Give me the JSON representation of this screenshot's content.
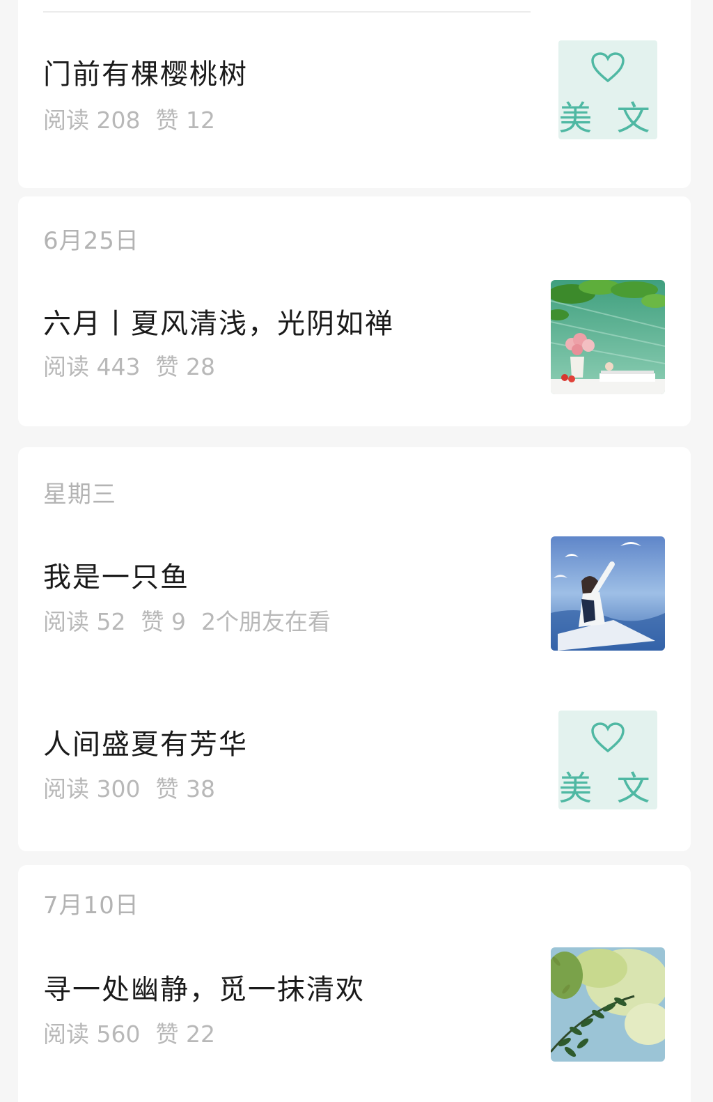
{
  "articles": [
    {
      "title": "门前有棵樱桃树",
      "reads": "阅读 208",
      "likes": "赞 12",
      "thumb_type": "meiwen",
      "thumb_text": "美 文"
    },
    {
      "date": "6月25日",
      "title": "六月丨夏风清浅，光阴如禅",
      "reads": "阅读 443",
      "likes": "赞 28",
      "thumb_type": "photo-lake-flowers"
    },
    {
      "date": "星期三",
      "title": "我是一只鱼",
      "reads": "阅读 52",
      "likes": "赞 9",
      "friends": "2个朋友在看",
      "thumb_type": "photo-girl-seagulls"
    },
    {
      "title": "人间盛夏有芳华",
      "reads": "阅读 300",
      "likes": "赞 38",
      "thumb_type": "meiwen",
      "thumb_text": "美 文"
    },
    {
      "date": "7月10日",
      "title": "寻一处幽静，觅一抹清欢",
      "reads": "阅读 560",
      "likes": "赞 22",
      "thumb_type": "photo-leaves"
    }
  ],
  "colors": {
    "background": "#f6f6f6",
    "card": "#ffffff",
    "title": "#1a1a1a",
    "meta": "#b8b8b8",
    "meiwen_bg": "#e3f2ee",
    "meiwen_accent": "#4fb8a3"
  },
  "icons": {
    "meiwen_heart": "heart-outline-icon"
  }
}
